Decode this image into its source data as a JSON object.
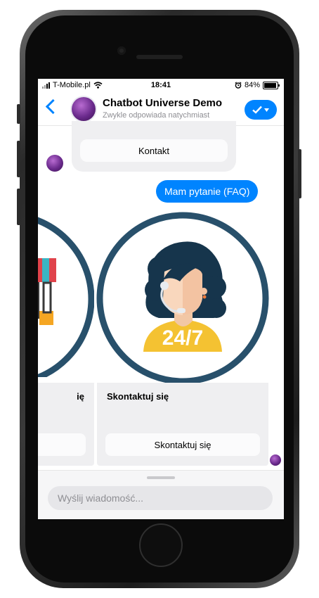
{
  "status_bar": {
    "carrier": "T-Mobile.pl",
    "time": "18:41",
    "battery_text": "84%",
    "battery_level": 0.84
  },
  "header": {
    "title": "Chatbot Universe Demo",
    "subtitle": "Zwykle odpowiada natychmiast",
    "accent_color": "#0084ff"
  },
  "conversation": {
    "bot_button_label": "Kontakt",
    "user_message": "Mam pytanie (FAQ)",
    "carousel": {
      "left_card_title": "ię",
      "main_card_title": "Skontaktuj się",
      "main_card_button": "Skontaktuj się",
      "badge_text": "24/7"
    }
  },
  "composer": {
    "placeholder": "Wyślij wiadomość..."
  },
  "icons": [
    "back-icon",
    "check-icon",
    "dropdown-arrow-icon",
    "wifi-icon",
    "alarm-icon",
    "battery-icon",
    "signal-icon"
  ],
  "colors": {
    "brand_blue": "#0084ff",
    "ring": "#28506b",
    "shirt": "#f4c232",
    "bubble_gray": "#efeff1"
  }
}
